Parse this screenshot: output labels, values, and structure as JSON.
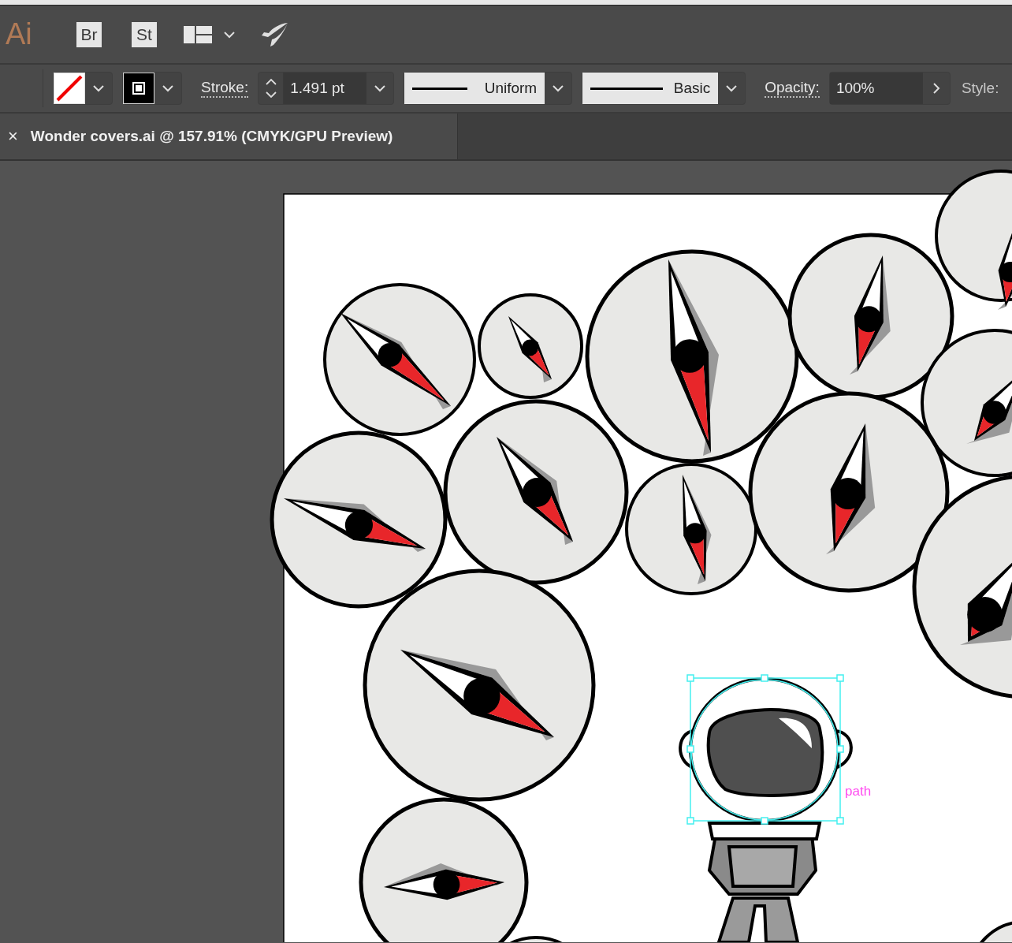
{
  "app_bar": {
    "logo": "Ai",
    "apps": [
      "Br",
      "St"
    ]
  },
  "control_bar": {
    "stroke_label": "Stroke:",
    "stroke_weight": "1.491 pt",
    "variable_width_profile": "Uniform",
    "brush": "Basic",
    "opacity_label": "Opacity:",
    "opacity": "100%",
    "style_label": "Style:"
  },
  "document_tab": {
    "close": "×",
    "title": "Wonder covers.ai @ 157.91% (CMYK/GPU Preview)"
  },
  "canvas": {
    "selection_label": "path"
  }
}
